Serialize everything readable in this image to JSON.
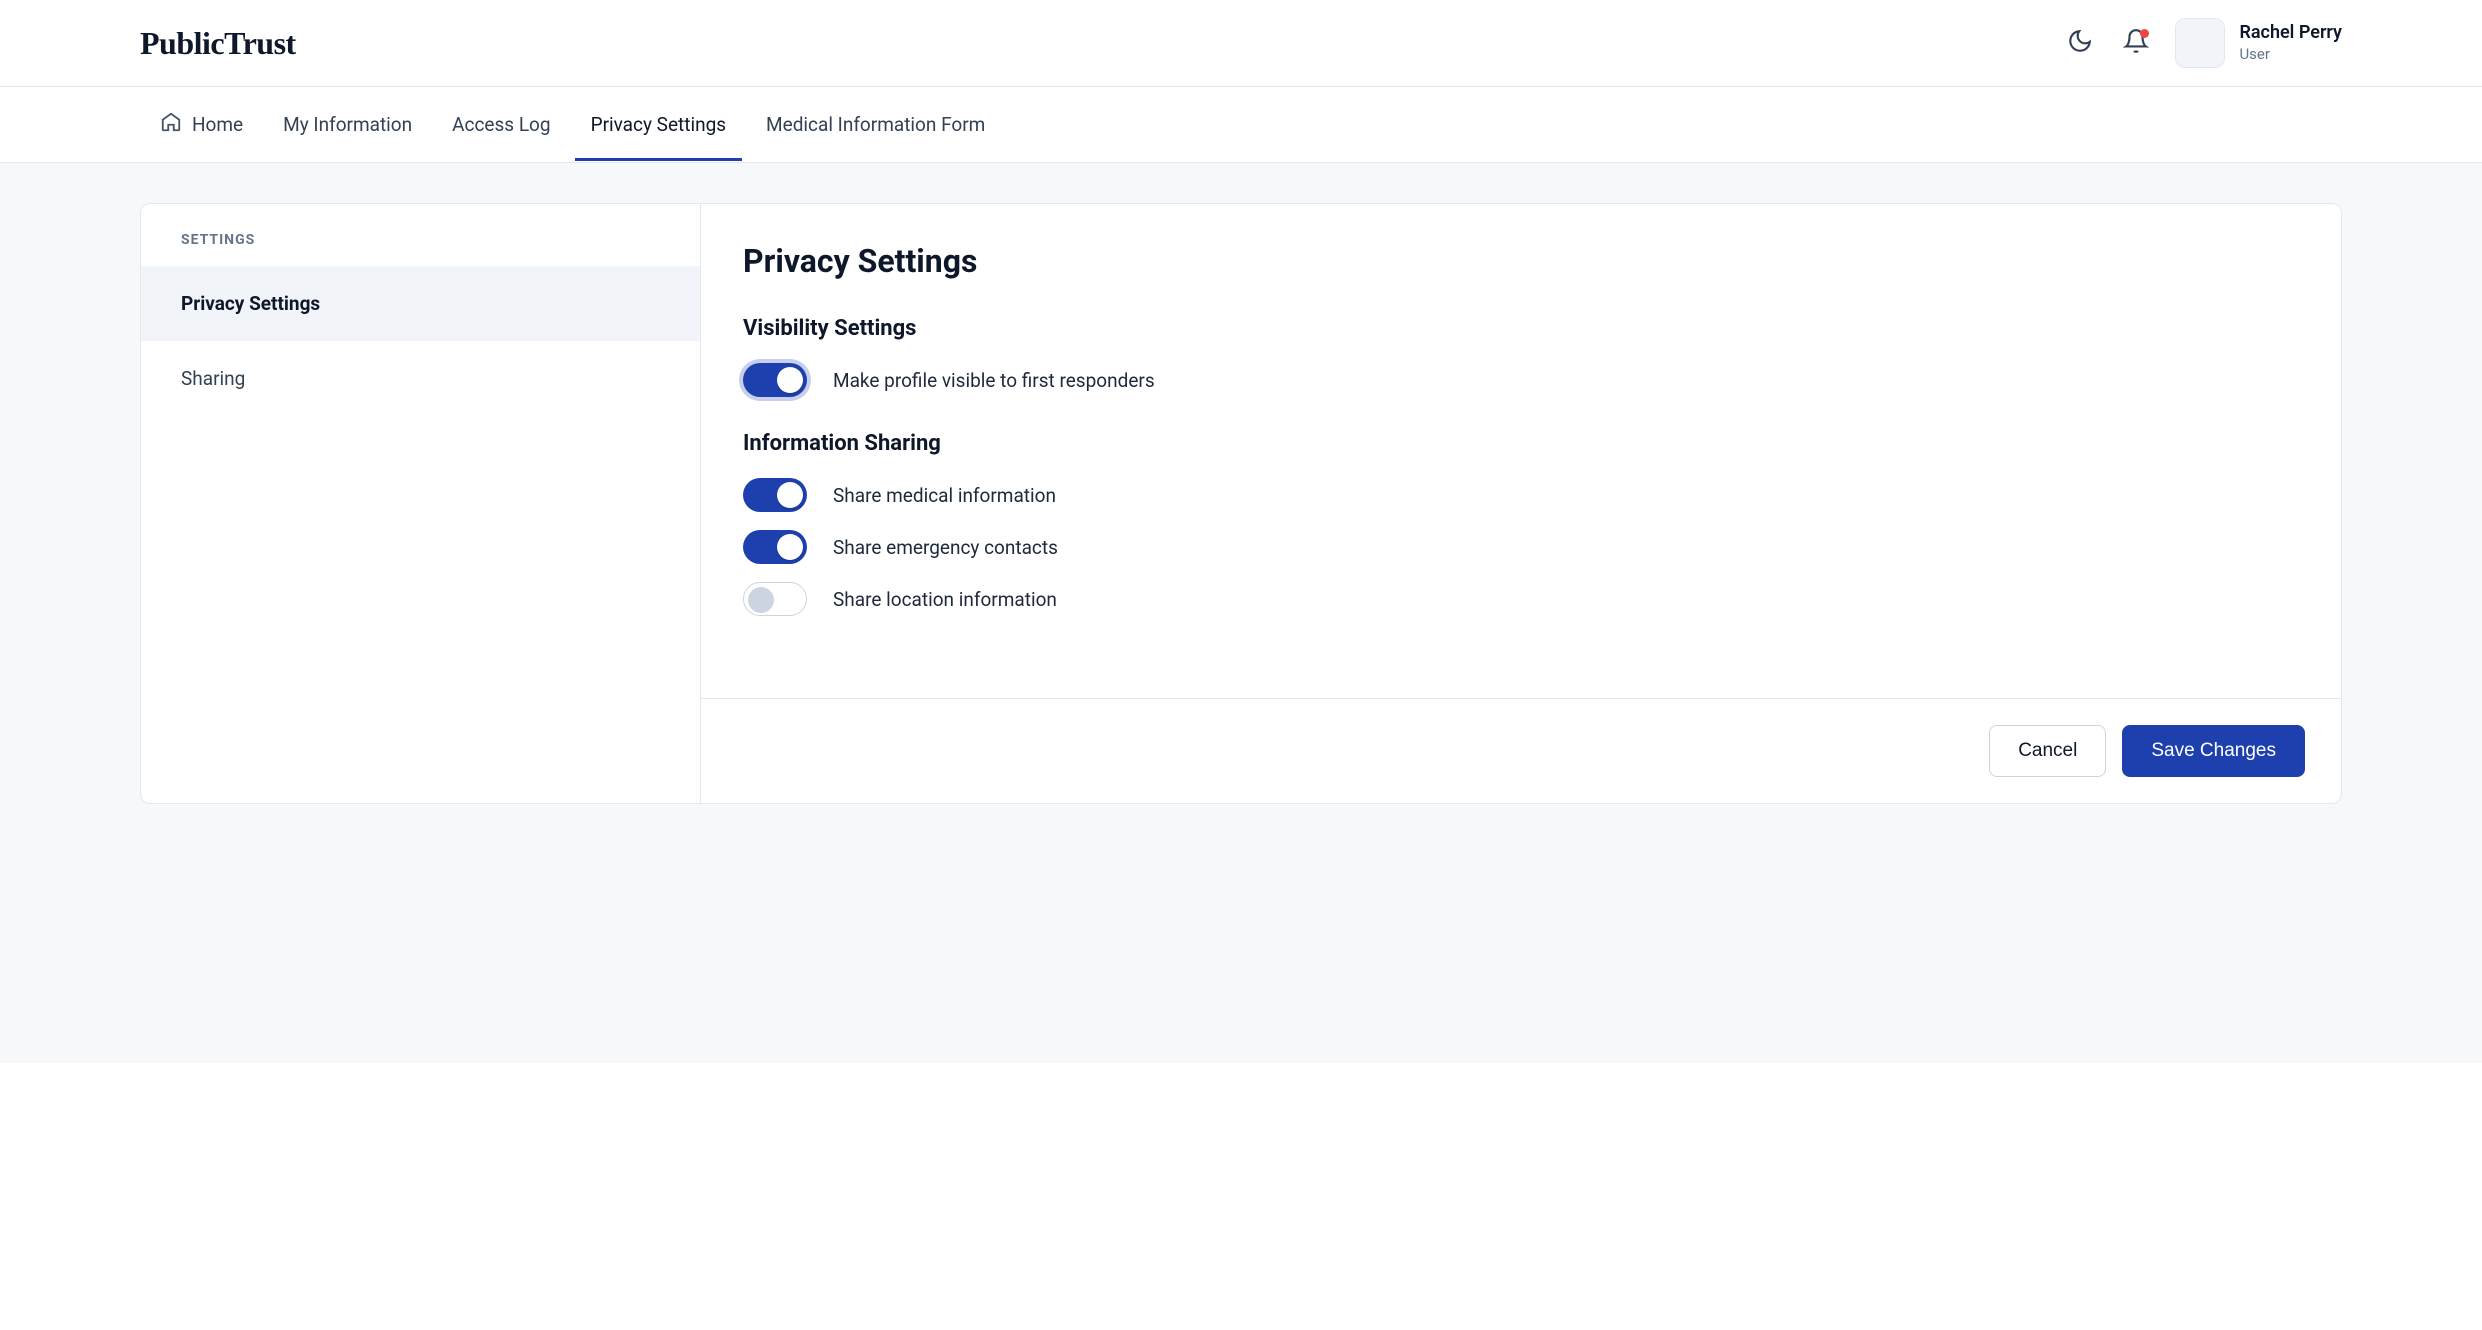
{
  "header": {
    "logo": "PublicTrust",
    "user_name": "Rachel Perry",
    "user_role": "User"
  },
  "nav": {
    "items": [
      {
        "label": "Home"
      },
      {
        "label": "My Information"
      },
      {
        "label": "Access Log"
      },
      {
        "label": "Privacy Settings"
      },
      {
        "label": "Medical Information Form"
      }
    ]
  },
  "sidebar": {
    "heading": "SETTINGS",
    "items": [
      {
        "label": "Privacy Settings"
      },
      {
        "label": "Sharing"
      }
    ]
  },
  "main": {
    "title": "Privacy Settings",
    "sections": {
      "visibility": {
        "title": "Visibility Settings",
        "toggles": [
          {
            "label": "Make profile visible to first responders",
            "on": true,
            "focused": true
          }
        ]
      },
      "sharing": {
        "title": "Information Sharing",
        "toggles": [
          {
            "label": "Share medical information",
            "on": true
          },
          {
            "label": "Share emergency contacts",
            "on": true
          },
          {
            "label": "Share location information",
            "on": false
          }
        ]
      }
    },
    "footer": {
      "cancel": "Cancel",
      "save": "Save Changes"
    }
  }
}
